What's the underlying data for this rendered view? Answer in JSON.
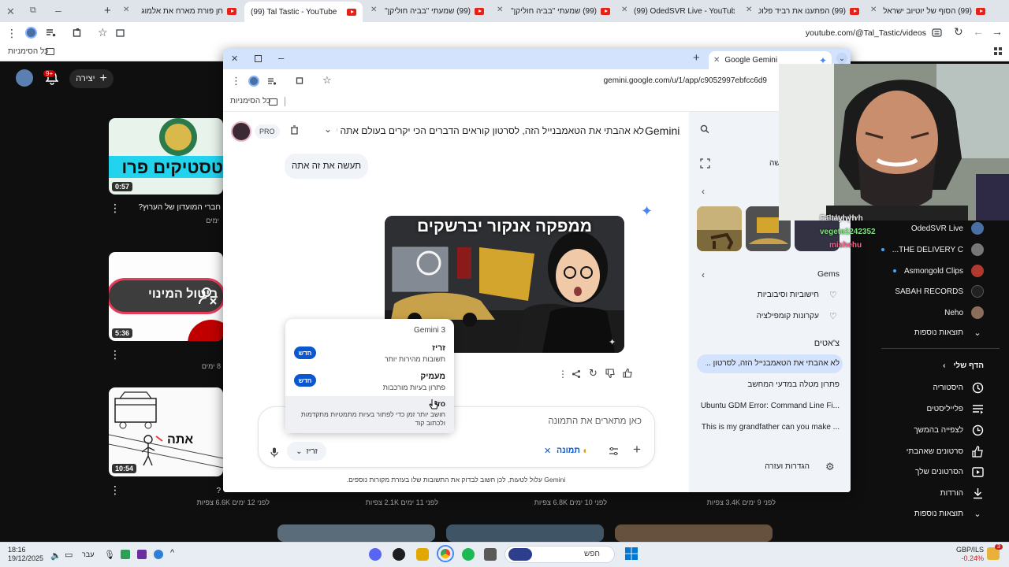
{
  "outer_browser": {
    "tabs": [
      {
        "label": "חן פורת מארח את אלמוג",
        "active": false
      },
      {
        "label": "(99) Tal Tastic - YouTube",
        "active": true
      },
      {
        "label": "(99) שמעתי \"בביה חוליקן\" למט",
        "active": false
      },
      {
        "label": "(99) שמעתי \"בביה חוליקן\" למט",
        "active": false
      },
      {
        "label": "(99) OdedSVR Live - YouTube",
        "active": false
      },
      {
        "label": "(99) הפתענו את רביד פלוטניק",
        "active": false
      },
      {
        "label": "(99) הסוף של יוטיוב ישראל! (נט",
        "active": false
      }
    ],
    "url": "youtube.com/@Tal_Tastic/videos",
    "bookmarks_label": "כל הסימניות"
  },
  "youtube": {
    "create_label": "יצירה",
    "notif_badge": "9+",
    "videos": [
      {
        "duration": "0:57",
        "thumb_text": "טסטיקים פרו",
        "title": "חברי המועדון של הערוץ?",
        "meta": "ימים"
      },
      {
        "duration": "5:36",
        "thumb_text": "ביטול המינוי",
        "title": "א",
        "meta": "8 ימים"
      },
      {
        "duration": "10:54",
        "thumb_text": "אתה",
        "title": "?",
        "meta": "לפני 12 ימים 6.6K צפיות"
      }
    ],
    "bottom_meta": [
      "לפני 11 ימים 2.1K צפיות",
      "לפני 10 ימים 6.8K צפיות",
      "לפני 9 ימים 3.4K צפיות"
    ],
    "subscriptions": [
      {
        "name": "OdedSVR Live",
        "dot": false,
        "color": "#4a6fa5"
      },
      {
        "name": "THE DELIVERY C...",
        "dot": true,
        "color": "#777777"
      },
      {
        "name": "Asmongold Clips",
        "dot": true,
        "color": "#b03a2e"
      },
      {
        "name": "SABAH RECORDS",
        "dot": false,
        "color": "#222222"
      },
      {
        "name": "Neho",
        "dot": false,
        "color": "#8a6d5a"
      }
    ],
    "show_more_1": "תוצאות נוספות",
    "you_header": "הדף שלי",
    "you_items": [
      {
        "label": "היסטוריה",
        "icon": "history-icon"
      },
      {
        "label": "פלייליסטים",
        "icon": "playlist-icon"
      },
      {
        "label": "לצפייה בהמשך",
        "icon": "clock-icon"
      },
      {
        "label": "סרטונים שאהבתי",
        "icon": "thumb-up-icon"
      },
      {
        "label": "הסרטונים שלך",
        "icon": "play-square-icon"
      },
      {
        "label": "הורדות",
        "icon": "download-icon"
      }
    ],
    "show_more_2": "תוצאות נוספות"
  },
  "gemini_window": {
    "tab_title": "Google Gemini",
    "url": "gemini.google.com/u/1/app/c9052997ebfcc6d9",
    "bookmarks_label": "כל הסימניות",
    "brand": "Gemini",
    "conversation_title": "לא אהבתי את הטאמבנייל הזה, לסרטון קוראים הדברים הכי יקרים בעולם אתה יכול...",
    "pro_badge": "PRO",
    "user_message": "תעשה את זה אתה",
    "image_headline": "ממפקה אנקור יברשקים",
    "input_placeholder": "כאן מתארים את התמונה",
    "tool_chip": "תמונה",
    "model_selector": "זריז",
    "disclaimer": "Gemini עלול לטעות, לכן חשוב לבדוק את התשובות שלו בעזרת מקורות נוספים.",
    "model_menu": {
      "header": "Gemini 3",
      "new_badge": "חדש",
      "options": [
        {
          "name": "זריז",
          "desc": "תשובות מהירות יותר",
          "new": true
        },
        {
          "name": "מעמיק",
          "desc": "פתרון בעיות מורכבות",
          "new": true
        },
        {
          "name": "Pro",
          "desc": "חושב יותר זמן כדי לפתור בעיות מתמטיות מתקדמות ולכתוב קוד",
          "new": false
        }
      ]
    },
    "sidebar": {
      "new_chat_label": "שה",
      "gems_header": "Gems",
      "gems": [
        "חישוביות וסיבוביות",
        "עקרונות קומפילציה"
      ],
      "chats_header": "צ'אטים",
      "chats": [
        "לא אהבתי את הטאמבנייל הזה, לסרטון ...",
        "פתרון מטלה במדעי המחשב",
        "Ubuntu GDM Error: Command Line Fi...",
        "This is my grandfather can you make ..."
      ],
      "settings_label": "הגדרות ועזרה"
    }
  },
  "webcam": {
    "chat": [
      {
        "user": "Faltayhyh",
        "color": "#e8e8e8"
      },
      {
        "user": "vegeta1242352",
        "color": "#7ee27e"
      },
      {
        "user": "mishehu",
        "color": "#ff5c8a"
      }
    ]
  },
  "taskbar": {
    "time": "18:16",
    "date": "19/12/2025",
    "lang": "עבר",
    "search_placeholder": "חפש",
    "ticker": "GBP/ILS",
    "ticker_change": "-0.24%",
    "notif_count": "3"
  }
}
